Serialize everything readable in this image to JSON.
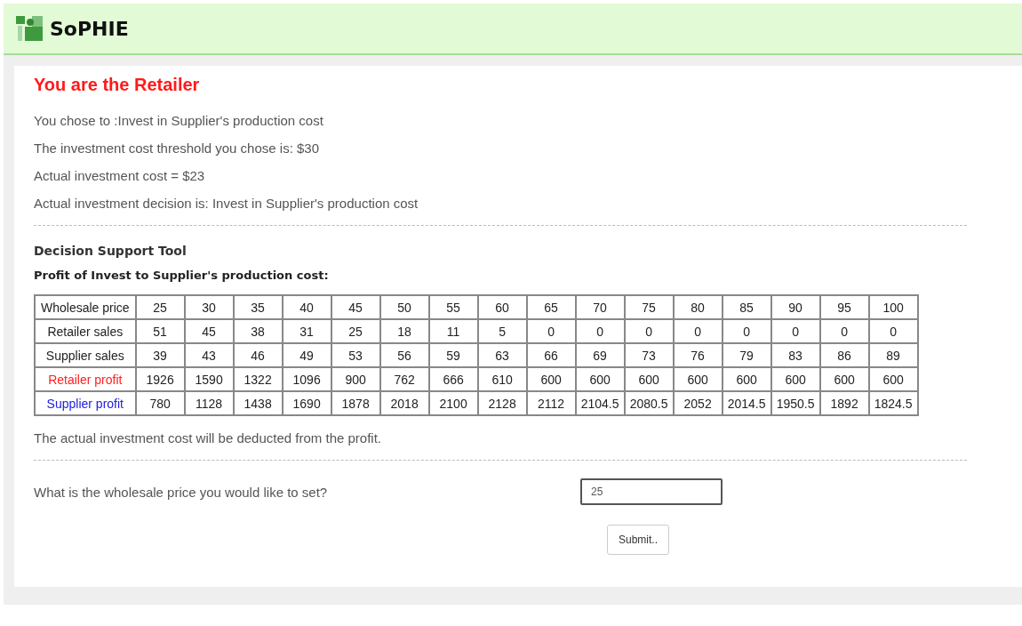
{
  "header": {
    "title": "SoPHIE"
  },
  "role_heading": "You are the Retailer",
  "info_lines": [
    "You chose to :Invest in Supplier's production cost",
    "The investment cost threshold you chose is: $30",
    "Actual investment cost = $23",
    "Actual investment decision is: Invest in Supplier's production cost"
  ],
  "tool_title": "Decision Support Tool",
  "table_caption": "Profit of Invest to Supplier's production cost:",
  "table": {
    "rows": [
      {
        "label": "Wholesale price",
        "color": "#222222",
        "values": [
          "25",
          "30",
          "35",
          "40",
          "45",
          "50",
          "55",
          "60",
          "65",
          "70",
          "75",
          "80",
          "85",
          "90",
          "95",
          "100"
        ]
      },
      {
        "label": "Retailer sales",
        "color": "#222222",
        "values": [
          "51",
          "45",
          "38",
          "31",
          "25",
          "18",
          "11",
          "5",
          "0",
          "0",
          "0",
          "0",
          "0",
          "0",
          "0",
          "0"
        ]
      },
      {
        "label": "Supplier sales",
        "color": "#222222",
        "values": [
          "39",
          "43",
          "46",
          "49",
          "53",
          "56",
          "59",
          "63",
          "66",
          "69",
          "73",
          "76",
          "79",
          "83",
          "86",
          "89"
        ]
      },
      {
        "label": "Retailer profit",
        "color": "#ff2020",
        "values": [
          "1926",
          "1590",
          "1322",
          "1096",
          "900",
          "762",
          "666",
          "610",
          "600",
          "600",
          "600",
          "600",
          "600",
          "600",
          "600",
          "600"
        ]
      },
      {
        "label": "Supplier profit",
        "color": "#2020e0",
        "values": [
          "780",
          "1128",
          "1438",
          "1690",
          "1878",
          "2018",
          "2100",
          "2128",
          "2112",
          "2104.5",
          "2080.5",
          "2052",
          "2014.5",
          "1950.5",
          "1892",
          "1824.5"
        ]
      }
    ]
  },
  "note": "The actual investment cost will be deducted from the profit.",
  "question": {
    "label": "What is the wholesale price you would like to set?",
    "value": "25"
  },
  "submit_button": "Submit.."
}
